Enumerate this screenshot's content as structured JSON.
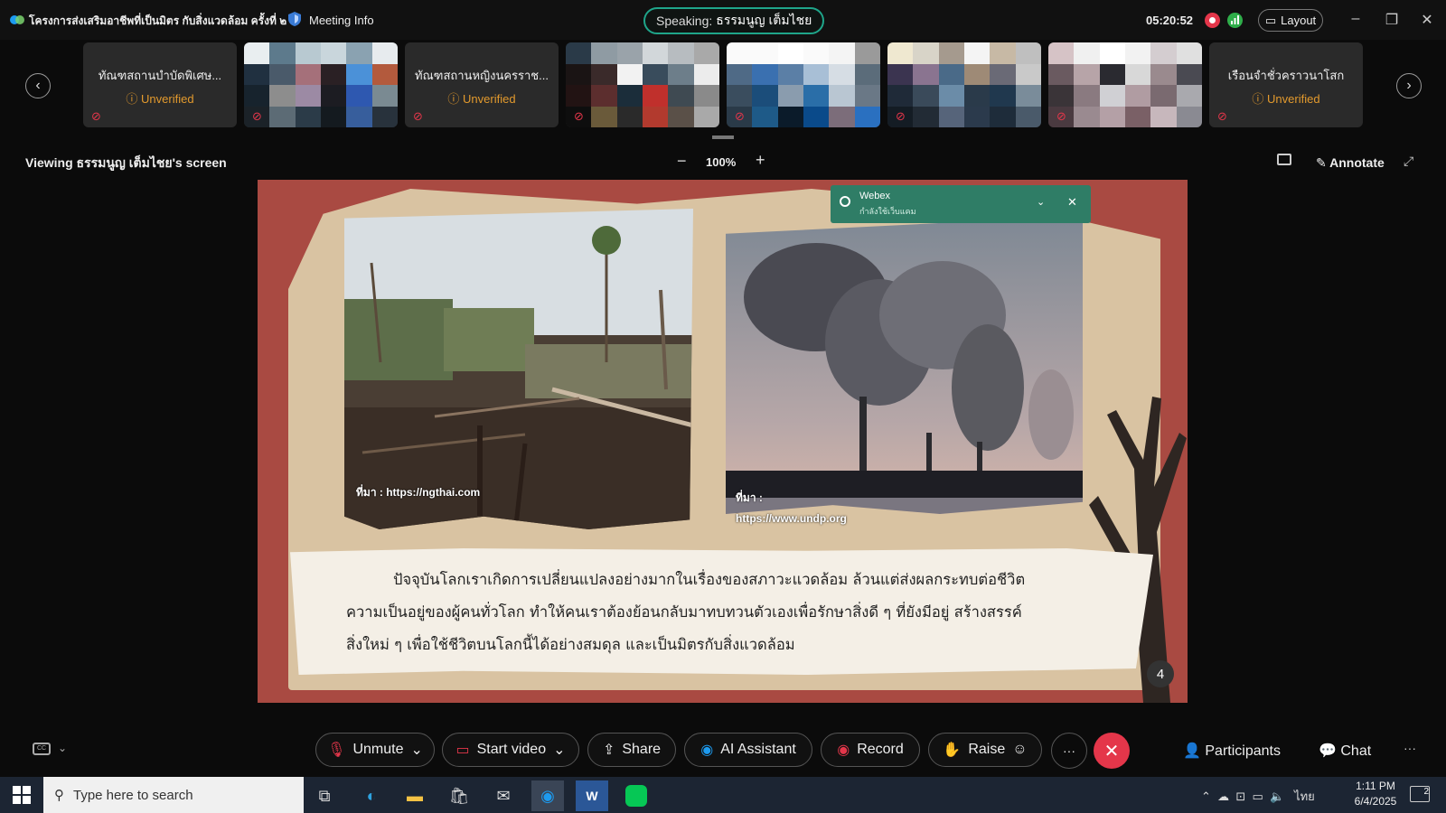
{
  "top_bar": {
    "app_title": "โครงการส่งเสริมอาชีพที่เป็นมิตร กับสิ่งแวดล้อม ครั้งที่ ๒",
    "meeting_info_label": "Meeting Info",
    "speaking_label": "Speaking:",
    "speaking_name": "ธรรมนูญ เต็มไชย",
    "timer": "05:20:52",
    "layout_label": "Layout"
  },
  "participants_strip": {
    "tiles": [
      {
        "name": "ทัณฑสถานบำบัดพิเศษ...",
        "status": "Unverified",
        "type": "name"
      },
      {
        "type": "video"
      },
      {
        "name": "ทัณฑสถานหญิงนครราช...",
        "status": "Unverified",
        "type": "name"
      },
      {
        "type": "video"
      },
      {
        "type": "video"
      },
      {
        "type": "video"
      },
      {
        "type": "video"
      },
      {
        "name": "เรือนจำชั่วคราวนาโสก",
        "status": "Unverified",
        "type": "name"
      }
    ]
  },
  "viewing_bar": {
    "viewing_label": "Viewing ธรรมนูญ เต็มไชย's screen",
    "zoom_level": "100%",
    "annotate_label": "Annotate"
  },
  "slide": {
    "source1": "ที่มา : https://ngthai.com",
    "source2_line1": "ที่มา :",
    "source2_line2": "https://www.undp.org",
    "paragraph_line1": "ปัจจุบันโลกเราเกิดการเปลี่ยนแปลงอย่างมากในเรื่องของสภาวะแวดล้อม    ล้วนแต่ส่งผลกระทบต่อชีวิต",
    "paragraph_line2": "ความเป็นอยู่ของผู้คนทั่วโลก ทำให้คนเราต้องย้อนกลับมาทบทวนตัวเองเพื่อรักษาสิ่งดี ๆ ที่ยังมีอยู่ สร้างสรรค์",
    "paragraph_line3": "สิ่งใหม่ ๆ เพื่อใช้ชีวิตบนโลกนี้ได้อย่างสมดุล และเป็นมิตรกับสิ่งแวดล้อม",
    "page_number": "4"
  },
  "toast": {
    "title": "Webex",
    "subtitle": "กำลังใช้เว็บแคม"
  },
  "controls": {
    "unmute": "Unmute",
    "start_video": "Start video",
    "share": "Share",
    "ai_assistant": "AI Assistant",
    "record": "Record",
    "raise": "Raise",
    "participants": "Participants",
    "chat": "Chat"
  },
  "taskbar": {
    "search_placeholder": "Type here to search",
    "language": "ไทย",
    "time": "1:11 PM",
    "date": "6/4/2025",
    "notifications": "2"
  },
  "colors": {
    "accent_red": "#e4364a",
    "speaking_border": "#1fa58a",
    "unverified": "#e39a2d",
    "toast_green": "#2f7d66"
  }
}
